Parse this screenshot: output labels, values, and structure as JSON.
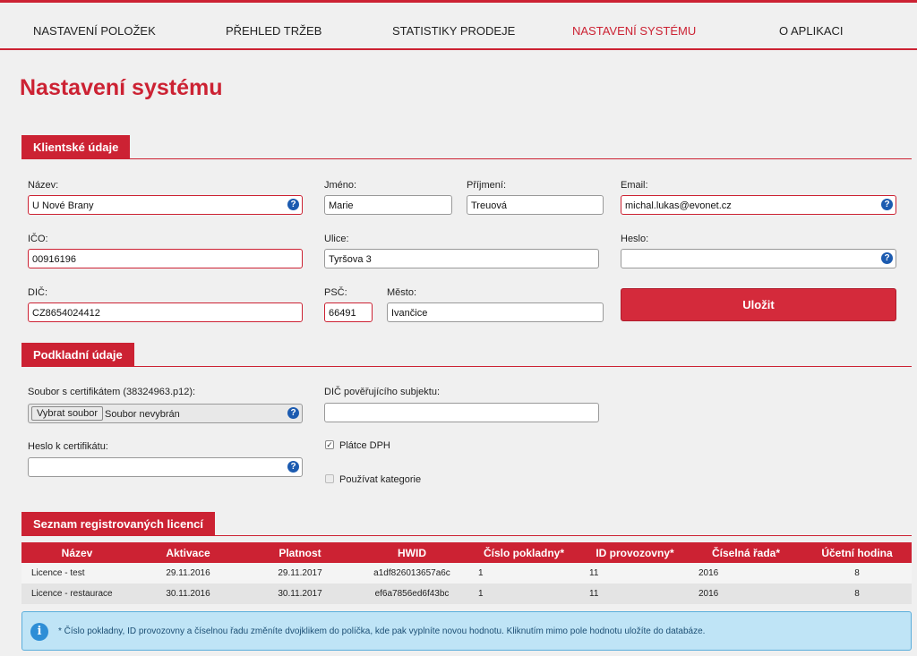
{
  "nav": {
    "items": [
      {
        "label": "NASTAVENÍ POLOŽEK"
      },
      {
        "label": "PŘEHLED TRŽEB"
      },
      {
        "label": "STATISTIKY PRODEJE"
      },
      {
        "label": "NASTAVENÍ SYSTÉMU"
      },
      {
        "label": "O APLIKACI"
      }
    ],
    "active_index": 3,
    "accent_color": "#cc2233"
  },
  "page_title": "Nastavení systému",
  "client": {
    "heading": "Klientské údaje",
    "name": {
      "label": "Název:",
      "value": "U Nové Brany"
    },
    "first_name": {
      "label": "Jméno:",
      "value": "Marie"
    },
    "last_name": {
      "label": "Příjmení:",
      "value": "Treuová"
    },
    "email": {
      "label": "Email:",
      "value": "michal.lukas@evonet.cz"
    },
    "ico": {
      "label": "IČO:",
      "value": "00916196"
    },
    "street": {
      "label": "Ulice:",
      "value": "Tyršova 3"
    },
    "password": {
      "label": "Heslo:",
      "value": ""
    },
    "dic": {
      "label": "DIČ:",
      "value": "CZ8654024412"
    },
    "zip": {
      "label": "PSČ:",
      "value": "66491"
    },
    "city": {
      "label": "Město:",
      "value": "Ivančice"
    },
    "save_label": "Uložit",
    "help_glyph": "?"
  },
  "base": {
    "heading": "Podkladní údaje",
    "cert_file": {
      "label": "Soubor s certifikátem (38324963.p12):",
      "button": "Vybrat soubor",
      "status": "Soubor nevybrán"
    },
    "delegating_dic": {
      "label": "DIČ pověřujícího subjektu:",
      "value": ""
    },
    "cert_password": {
      "label": "Heslo k certifikátu:",
      "value": ""
    },
    "vat_payer": {
      "label": "Plátce DPH",
      "checked": true
    },
    "use_categories": {
      "label": "Používat kategorie",
      "checked": false
    }
  },
  "licenses": {
    "heading": "Seznam registrovaných licencí",
    "columns": [
      "Název",
      "Aktivace",
      "Platnost",
      "HWID",
      "Číslo pokladny*",
      "ID provozovny*",
      "Číselná řada*",
      "Účetní hodina"
    ],
    "rows": [
      [
        "Licence - test",
        "29.11.2016",
        "29.11.2017",
        "a1df826013657a6c",
        "1",
        "11",
        "2016",
        "8"
      ],
      [
        "Licence - restaurace",
        "30.11.2016",
        "30.11.2017",
        "ef6a7856ed6f43bc",
        "1",
        "11",
        "2016",
        "8"
      ]
    ]
  },
  "info": {
    "icon": "info-icon",
    "glyph": "i",
    "text": "* Číslo pokladny, ID provozovny a číselnou řadu změníte dvojklikem do políčka, kde pak vyplníte novou hodnotu. Kliknutím mimo pole hodnotu uložíte do databáze."
  }
}
